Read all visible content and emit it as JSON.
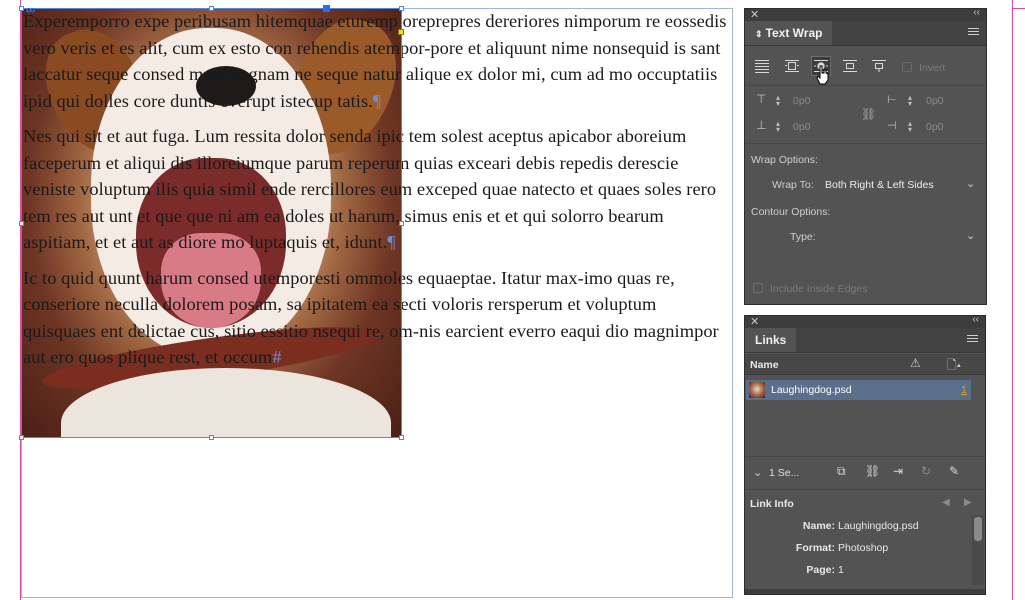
{
  "document": {
    "paragraphs": [
      {
        "text": "Experemporro expe peribusam hitemquae eturemp oreprepres dereriores nimporum re eossedis vero veris et es alit, cum ex esto con rehendis atempor-pore et aliquunt nime nonsequid is sant laccatur seque consed maximagnam ne seque natur alique ex dolor mi, cum ad mo occuptatiis ipid qui dolles core duntis everupt istecup tatis.",
        "end_mark": "¶"
      },
      {
        "text": "Nes qui sit et aut fuga. Lum ressita dolor senda ipic tem solest aceptus apicabor aboreium faceperum et aliqui dis illoreiumque parum reperum quias exceari debis repedis derescie veniste voluptum ilis quia simil ende rercillores eum exceped quae natecto et quaes soles rero tem res aut unt et que que ni am ea doles ut harum, simus enis et et qui solorro bearum aspitiam, et et aut as diore mo luptaquis et, idunt.",
        "end_mark": "¶"
      },
      {
        "text": "Ic to quid quunt harum consed utemporesti ommoles equaeptae. Itatur max-imo quas re, conseriore neculla dolorem posam, sa ipitatem ea secti voloris rersperum et voluptum quisquaes ent delictae cus, sitio essitio nsequi re, om-nis earcient everro eaqui dio magnimpor aut ero quos plique rest, et occum",
        "end_mark": "#"
      }
    ]
  },
  "text_wrap_panel": {
    "title": "Text Wrap",
    "invert_label": "Invert",
    "offsets": {
      "top": "0p0",
      "bottom": "0p0",
      "left": "0p0",
      "right": "0p0"
    },
    "wrap_options_label": "Wrap Options:",
    "wrap_to_label": "Wrap To:",
    "wrap_to_value": "Both Right & Left Sides",
    "contour_options_label": "Contour Options:",
    "type_label": "Type:",
    "type_value": "",
    "include_inside_edges_label": "Include Inside Edges",
    "selected_mode": "wrap-around-object-shape"
  },
  "links_panel": {
    "title": "Links",
    "col_name": "Name",
    "file_name": "Laughingdog.psd",
    "page_ref": "1",
    "selection_summary": "1 Se...",
    "link_info_label": "Link Info",
    "info": [
      {
        "key": "Name:",
        "value": "Laughingdog.psd"
      },
      {
        "key": "Format:",
        "value": "Photoshop"
      },
      {
        "key": "Page:",
        "value": "1"
      }
    ]
  },
  "colors": {
    "panel_bg": "#535353",
    "panel_header": "#3d3d3d",
    "selection_blue": "#4a8ae0",
    "margin_guide": "#e04aa0",
    "row_highlight": "#5a6f8c",
    "page_link_orange": "#e0a030"
  },
  "icons": [
    "close-icon",
    "collapse-icon",
    "panel-menu-icon",
    "no-wrap-icon",
    "wrap-bounding-box-icon",
    "wrap-object-shape-icon",
    "jump-object-icon",
    "jump-next-column-icon",
    "top-offset-icon",
    "bottom-offset-icon",
    "left-offset-icon",
    "right-offset-icon",
    "chain-icon",
    "chevron-down-icon",
    "warning-icon",
    "page-icon",
    "relink-icon",
    "go-to-link-icon",
    "update-link-icon",
    "edit-original-icon",
    "pointer-cursor-icon"
  ]
}
